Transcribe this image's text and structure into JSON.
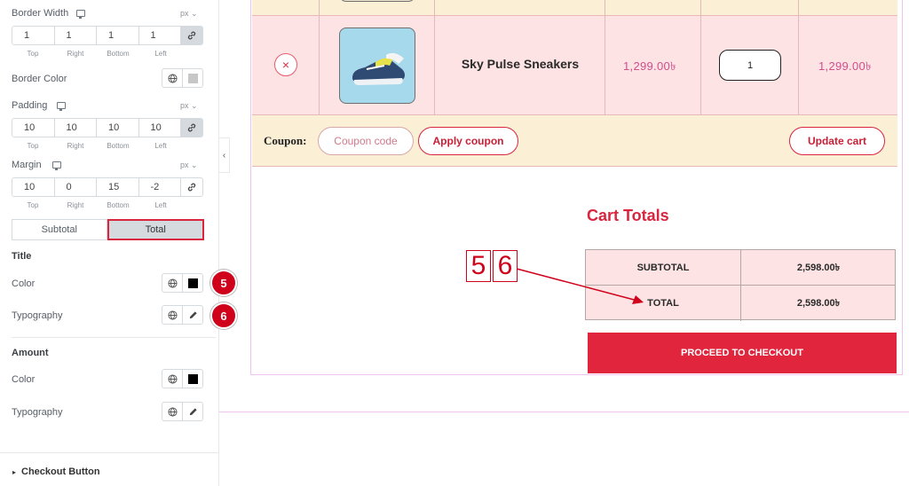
{
  "panel": {
    "border_width": {
      "label": "Border Width",
      "unit": "px ⌄",
      "values": [
        "1",
        "1",
        "1",
        "1"
      ]
    },
    "captions": {
      "top": "Top",
      "right": "Right",
      "bottom": "Bottom",
      "left": "Left"
    },
    "border_color": {
      "label": "Border Color"
    },
    "padding": {
      "label": "Padding",
      "unit": "px ⌄",
      "values": [
        "10",
        "10",
        "10",
        "10"
      ]
    },
    "margin": {
      "label": "Margin",
      "unit": "px ⌄",
      "values": [
        "10",
        "0",
        "15",
        "-2"
      ]
    },
    "tabs": {
      "subtotal": "Subtotal",
      "total": "Total"
    },
    "title_section": {
      "heading": "Title",
      "color": "Color",
      "typography": "Typography"
    },
    "amount_section": {
      "heading": "Amount",
      "color": "Color",
      "typography": "Typography"
    },
    "checkout_button": "Checkout Button",
    "badges": {
      "five": "5",
      "six": "6"
    },
    "accent_color": "#d0021b"
  },
  "cart": {
    "product_name": "Sky Pulse Sneakers",
    "price": "1,299.00৳",
    "subtotal_price": "1,299.00৳",
    "quantity": "1",
    "remove_icon": "×",
    "coupon_label": "Coupon:",
    "coupon_placeholder": "Coupon code",
    "apply_coupon": "Apply coupon",
    "update_cart": "Update cart"
  },
  "totals": {
    "title": "Cart Totals",
    "subtotal_label": "SUBTOTAL",
    "subtotal_value": "2,598.00৳",
    "total_label": "TOTAL",
    "total_value": "2,598.00৳",
    "checkout_label": "PROCEED TO CHECKOUT"
  },
  "annotations": {
    "five": "5",
    "six": "6"
  },
  "icons": {
    "collapse": "‹",
    "caret": "▸",
    "link": "🔗",
    "globe": "globe-icon",
    "pencil": "pencil-icon"
  },
  "colors": {
    "brand_red": "#e0253d",
    "row_pink": "#fde3e3",
    "row_cream": "#fbefd6",
    "price_pink": "#d24d8d"
  }
}
